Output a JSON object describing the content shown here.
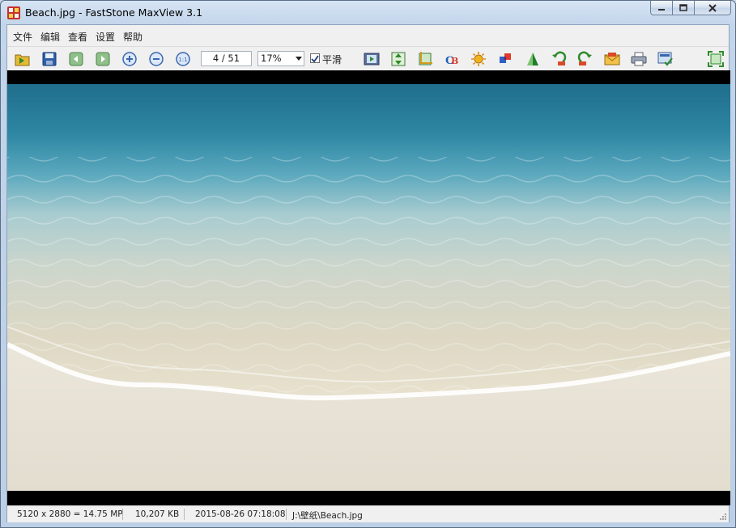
{
  "window": {
    "title": "Beach.jpg - FastStone MaxView 3.1"
  },
  "menu": [
    "文件",
    "编辑",
    "查看",
    "设置",
    "帮助"
  ],
  "toolbar": {
    "page_counter": "4 / 51",
    "zoom_value": "17%",
    "smooth_checked": true,
    "smooth_label": "平滑",
    "icons": [
      "open-folder-icon",
      "save-icon",
      "previous-image-icon",
      "next-image-icon",
      "zoom-in-icon",
      "zoom-out-icon",
      "actual-size-icon",
      "slideshow-icon",
      "resize-icon",
      "crop-icon",
      "text-icon",
      "brightness-icon",
      "color-adjust-icon",
      "sharpen-icon",
      "rotate-left-icon",
      "rotate-right-icon",
      "email-icon",
      "print-icon",
      "set-wallpaper-icon",
      "fullscreen-icon"
    ]
  },
  "status": {
    "dimensions": "5120 x 2880 = 14.75 MP",
    "file_size": "10,207 KB",
    "datetime": "2015-08-26 07:18:08",
    "path": "J:\\壁纸\\Beach.jpg"
  },
  "colors": {
    "viewer_bg": "#000000",
    "chrome": "#f0f0f0",
    "title_gradient": "#c2d5ea"
  }
}
